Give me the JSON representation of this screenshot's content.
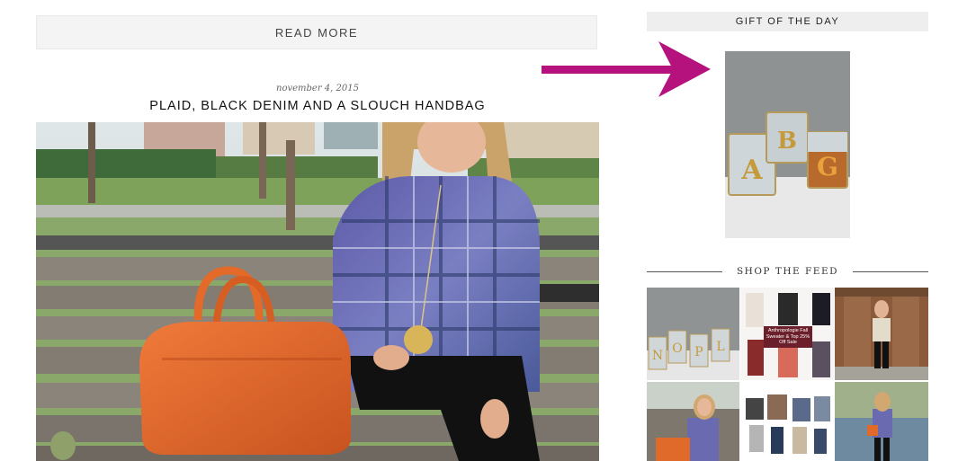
{
  "post": {
    "read_more": "READ MORE",
    "date": "november 4, 2015",
    "title": "PLAID, BLACK DENIM AND A SLOUCH HANDBAG"
  },
  "sidebar": {
    "gift_heading": "GIFT OF THE DAY",
    "gift_monograms": [
      "A",
      "B",
      "G"
    ],
    "feed_heading": "SHOP THE FEED",
    "feed_items": [
      {
        "overlay": ""
      },
      {
        "overlay": "Anthropologie Fall Sweater & Top 25% Off Sale"
      },
      {
        "overlay": ""
      },
      {
        "overlay": ""
      },
      {
        "overlay": ""
      },
      {
        "overlay": ""
      }
    ]
  },
  "colors": {
    "arrow": "#b5127e",
    "heading_bg": "#eeeeee",
    "read_more_bg": "#f4f4f4"
  }
}
